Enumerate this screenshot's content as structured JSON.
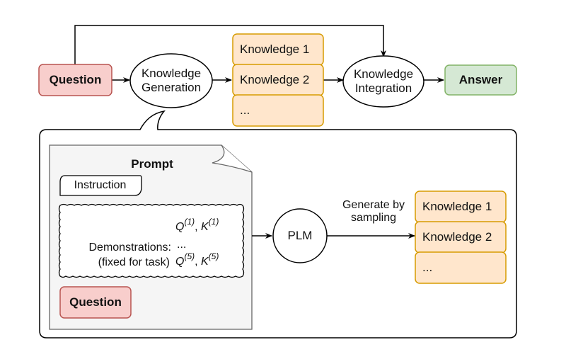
{
  "diagram": {
    "top_flow": {
      "question": "Question",
      "knowledge_generation": [
        "Knowledge",
        "Generation"
      ],
      "knowledge_items": [
        "Knowledge 1",
        "Knowledge 2",
        "..."
      ],
      "knowledge_integration": [
        "Knowledge",
        "Integration"
      ],
      "answer": "Answer"
    },
    "detail": {
      "prompt_title": "Prompt",
      "instruction": "Instruction",
      "demonstrations_label": "Demonstrations:",
      "demonstrations_sublabel": "(fixed for task)",
      "demo_first": {
        "q": "Q",
        "q_sup": "(1)",
        "sep": ", ",
        "k": "K",
        "k_sup": "(1)"
      },
      "demo_ellipsis": "...",
      "demo_last": {
        "q": "Q",
        "q_sup": "(5)",
        "sep": ", ",
        "k": "K",
        "k_sup": "(5)"
      },
      "question": "Question",
      "plm": "PLM",
      "edge_label": [
        "Generate by",
        "sampling"
      ],
      "knowledge_items": [
        "Knowledge 1",
        "Knowledge 2",
        "..."
      ]
    },
    "colors": {
      "question_fill": "#f8cecc",
      "question_stroke": "#b85450",
      "knowledge_fill": "#ffe6cc",
      "knowledge_stroke": "#d79b00",
      "answer_fill": "#d5e8d4",
      "answer_stroke": "#82b366",
      "prompt_fill": "#f5f5f5",
      "prompt_stroke": "#666666"
    }
  }
}
